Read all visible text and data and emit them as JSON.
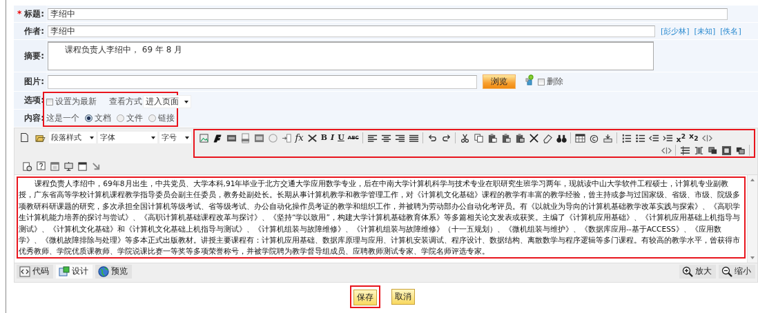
{
  "title_row": {
    "required_mark": "*",
    "label": "标题:",
    "value": "李绍中"
  },
  "author_row": {
    "label": "作者:",
    "value": "李绍中",
    "links": [
      "[彭少林]",
      "[未知]",
      "[佚名]"
    ]
  },
  "summary_row": {
    "label": "摘要:",
    "value": "课程负责人李绍中， 69 年 8 月"
  },
  "image_row": {
    "label": "图片:",
    "browse": "浏览",
    "delete": {
      "label": "删除",
      "checked": false
    }
  },
  "options_row": {
    "label": "选项:",
    "latest": {
      "label": "设置为最新",
      "checked": false
    },
    "view_label": "查看方式",
    "view_value": "进入页面"
  },
  "content_row": {
    "label": "内容:",
    "prefix": "这是一个",
    "types": [
      {
        "label": "文档",
        "selected": true
      },
      {
        "label": "文件",
        "selected": false
      },
      {
        "label": "链接",
        "selected": false
      }
    ]
  },
  "editor": {
    "selects": [
      "段落样式",
      "字体",
      "字号"
    ],
    "tools_a": [
      {
        "kind": "icon"
      },
      {
        "kind": "icon"
      },
      {
        "kind": "icon"
      },
      {
        "kind": "icon"
      },
      {
        "kind": "icon"
      },
      {
        "kind": "icon"
      },
      {
        "kind": "icon"
      },
      {
        "kind": "glyph",
        "text": "fx"
      },
      {
        "kind": "icon"
      },
      {
        "kind": "glyph",
        "text": "B"
      },
      {
        "kind": "glyph",
        "text": "I"
      },
      {
        "kind": "glyph",
        "text": "U"
      },
      {
        "kind": "glyph",
        "text": "ABC"
      },
      {
        "kind": "separator"
      },
      {
        "kind": "icon"
      },
      {
        "kind": "icon"
      },
      {
        "kind": "icon"
      },
      {
        "kind": "icon"
      },
      {
        "kind": "separator"
      },
      {
        "kind": "icon"
      },
      {
        "kind": "icon"
      },
      {
        "kind": "separator"
      },
      {
        "kind": "icon"
      },
      {
        "kind": "icon"
      },
      {
        "kind": "icon"
      },
      {
        "kind": "icon"
      },
      {
        "kind": "icon"
      },
      {
        "kind": "icon"
      },
      {
        "kind": "icon"
      },
      {
        "kind": "icon"
      },
      {
        "kind": "separator"
      },
      {
        "kind": "icon"
      },
      {
        "kind": "icon"
      },
      {
        "kind": "icon"
      },
      {
        "kind": "separator"
      },
      {
        "kind": "icon"
      },
      {
        "kind": "icon"
      },
      {
        "kind": "icon"
      },
      {
        "kind": "icon"
      },
      {
        "kind": "glyph",
        "text": "x$^{2}$"
      },
      {
        "kind": "glyph",
        "text": "x$_{2}$"
      },
      {
        "kind": "icon"
      }
    ],
    "tools_b": [
      {
        "kind": "icon"
      },
      {
        "kind": "separator"
      },
      {
        "kind": "icon"
      },
      {
        "kind": "icon"
      },
      {
        "kind": "icon"
      },
      {
        "kind": "icon"
      },
      {
        "kind": "icon"
      },
      {
        "kind": "separator"
      }
    ],
    "tools_c": [
      {
        "kind": "icon"
      },
      {
        "kind": "icon"
      },
      {
        "kind": "icon"
      },
      {
        "kind": "icon"
      },
      {
        "kind": "icon"
      },
      {
        "kind": "icon"
      }
    ],
    "body": "课程负责人李绍中，69年8月出生，中共党员、大学本科,91年毕业于北方交通大学应用数学专业，后在中南大学计算机科学与技术专业在职研究生班学习两年，现就读中山大学软件工程硕士，计算机专业副教授，广东省高等学校计算机课程教学指导委员会副主任委员，教务处副处长。长期从事计算机教学和教学管理工作，对《计算机文化基础》课程的教学有丰富的教学经验，曾主持或参与过国家级、省级、市级、院级多项教研科研课题的研究，多次承担全国计算机等级考试、省等级考试、办公自动化操作员考证的教学和组织工作，并被聘为劳动部办公自动化考评员。有《以就业为导向的计算机基础教学改革实践与探索》、《高职学生计算机能力培养的探讨与尝试》、《高职计算机基础课程改革与探讨》、《坚持“学以致用”，构建大学计算机基础教育体系》等多篇相关论文发表或获奖。主编了《计算机应用基础》、《计算机应用基础上机指导与测试》、《计算机文化基础》和《计算机文化基础上机指导与测试》、《计算机组装与故障维修》、《计算机组装与故障维修》（十一五规划）、《微机组装与维护》、《数据库应用--基于ACCESS》、《应用数学》、《微机故障排除与处理》等多本正式出版教材。讲授主要课程有：计算机应用基础、数据库原理与应用、计算机安装调试、程序设计、数据结构、离散数学与程序逻辑等多门课程。有较高的教学水平，曾获得市优秀教师、学院优质课教师、学院说课比赛一等奖等多项荣誉称号，并被学院聘为教学督导组成员、应聘教师测试专家、学院名师评选专家。",
    "modes": [
      {
        "label": "代码",
        "selected": false
      },
      {
        "label": "设计",
        "selected": true
      },
      {
        "label": "预览",
        "selected": false
      }
    ],
    "zoom": [
      "放大",
      "缩小"
    ]
  },
  "actions": [
    "保存",
    "取消"
  ]
}
